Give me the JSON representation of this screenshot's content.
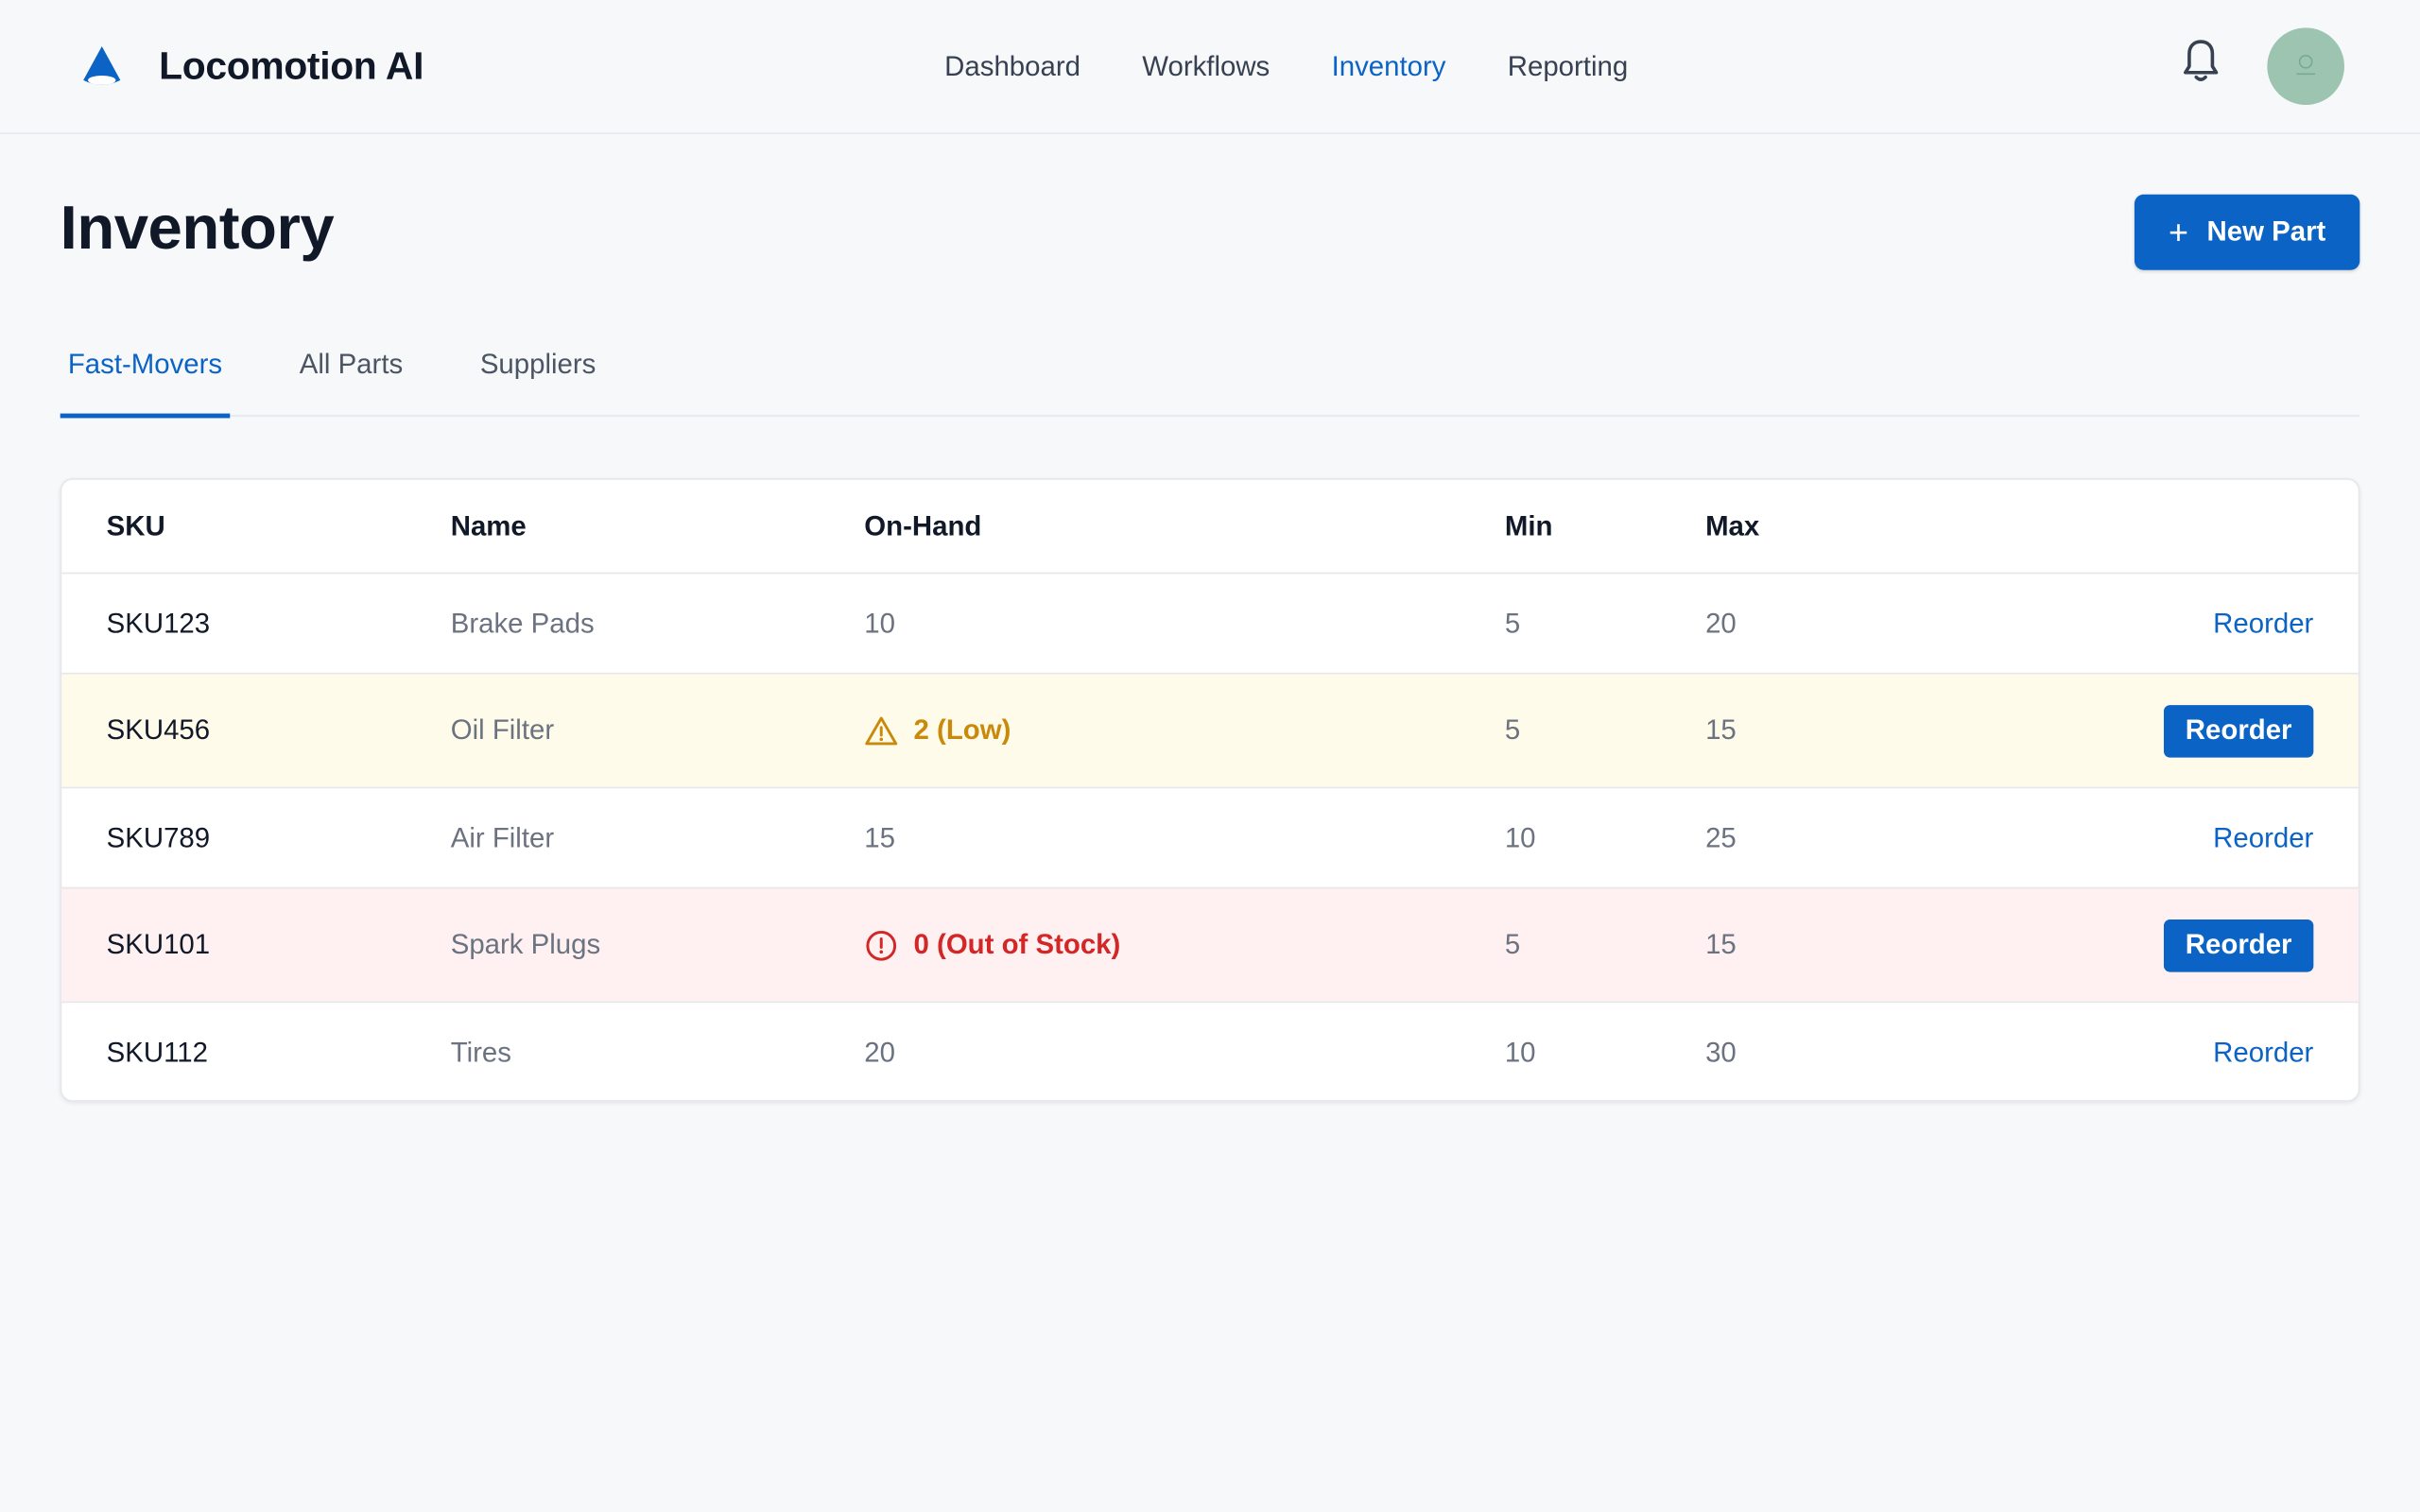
{
  "app": {
    "name": "Locomotion AI"
  },
  "nav": {
    "items": [
      {
        "label": "Dashboard",
        "active": false
      },
      {
        "label": "Workflows",
        "active": false
      },
      {
        "label": "Inventory",
        "active": true
      },
      {
        "label": "Reporting",
        "active": false
      }
    ]
  },
  "header": {
    "notifications_icon": "bell-icon",
    "avatar_icon": "avatar"
  },
  "page": {
    "title": "Inventory",
    "new_button_label": "New Part"
  },
  "tabs": [
    {
      "label": "Fast-Movers",
      "active": true
    },
    {
      "label": "All Parts",
      "active": false
    },
    {
      "label": "Suppliers",
      "active": false
    }
  ],
  "table": {
    "columns": [
      "SKU",
      "Name",
      "On-Hand",
      "Min",
      "Max"
    ],
    "rows": [
      {
        "sku": "SKU123",
        "name": "Brake Pads",
        "on_hand": "10",
        "min": "5",
        "max": "20",
        "status": "normal",
        "action": "Reorder"
      },
      {
        "sku": "SKU456",
        "name": "Oil Filter",
        "on_hand": "2 (Low)",
        "min": "5",
        "max": "15",
        "status": "low",
        "action": "Reorder"
      },
      {
        "sku": "SKU789",
        "name": "Air Filter",
        "on_hand": "15",
        "min": "10",
        "max": "25",
        "status": "normal",
        "action": "Reorder"
      },
      {
        "sku": "SKU101",
        "name": "Spark Plugs",
        "on_hand": "0 (Out of Stock)",
        "min": "5",
        "max": "15",
        "status": "out",
        "action": "Reorder"
      },
      {
        "sku": "SKU112",
        "name": "Tires",
        "on_hand": "20",
        "min": "10",
        "max": "30",
        "status": "normal",
        "action": "Reorder"
      }
    ]
  },
  "colors": {
    "accent": "#0b63c5",
    "warning": "#c98a0c",
    "danger": "#d32626",
    "warning_row_bg": "#fffbea",
    "danger_row_bg": "#fff1f1"
  }
}
